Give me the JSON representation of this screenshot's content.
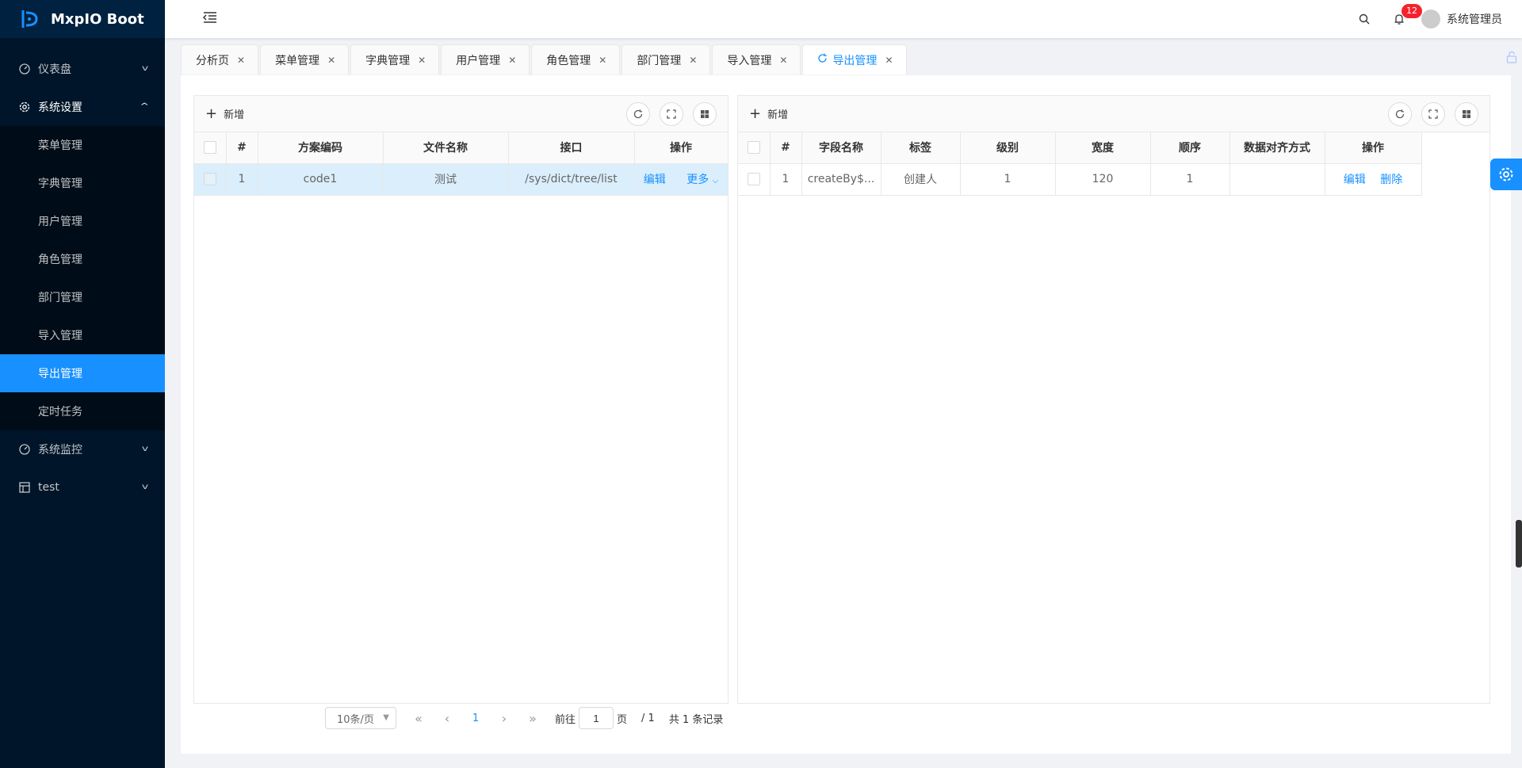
{
  "app": {
    "title": "MxpIO Boot"
  },
  "sidebar": {
    "items": [
      {
        "label": "仪表盘",
        "icon": "dashboard-icon"
      },
      {
        "label": "系统设置",
        "icon": "gear-icon"
      },
      {
        "label": "系统监控",
        "icon": "dashboard-icon"
      },
      {
        "label": "test",
        "icon": "table-icon"
      }
    ],
    "sub_items": [
      {
        "label": "菜单管理"
      },
      {
        "label": "字典管理"
      },
      {
        "label": "用户管理"
      },
      {
        "label": "角色管理"
      },
      {
        "label": "部门管理"
      },
      {
        "label": "导入管理"
      },
      {
        "label": "导出管理"
      },
      {
        "label": "定时任务"
      }
    ]
  },
  "header": {
    "notification_count": "12",
    "user_name": "系统管理员"
  },
  "tabs": [
    {
      "label": "分析页"
    },
    {
      "label": "菜单管理"
    },
    {
      "label": "字典管理"
    },
    {
      "label": "用户管理"
    },
    {
      "label": "角色管理"
    },
    {
      "label": "部门管理"
    },
    {
      "label": "导入管理"
    },
    {
      "label": "导出管理"
    }
  ],
  "left_panel": {
    "add_label": "新增",
    "columns": [
      "#",
      "方案编码",
      "文件名称",
      "接口",
      "操作"
    ],
    "rows": [
      {
        "index": "1",
        "code": "code1",
        "file_name": "测试",
        "api": "/sys/dict/tree/list",
        "edit": "编辑",
        "more": "更多"
      }
    ]
  },
  "right_panel": {
    "add_label": "新增",
    "columns": [
      "#",
      "字段名称",
      "标签",
      "级别",
      "宽度",
      "顺序",
      "数据对齐方式",
      "操作"
    ],
    "rows": [
      {
        "index": "1",
        "field": "createBy$...",
        "label": "创建人",
        "level": "1",
        "width": "120",
        "order": "1",
        "align": "",
        "edit": "编辑",
        "delete": "删除"
      }
    ]
  },
  "pagination": {
    "page_size": "10条/页",
    "current_page": "1",
    "goto_prefix": "前往",
    "goto_value": "1",
    "goto_suffix": "页",
    "total_pages": "/ 1",
    "total_records": "共 1 条记录"
  },
  "colors": {
    "sidebar_bg": "#001529",
    "accent": "#1890ff",
    "badge": "#f5222d"
  }
}
